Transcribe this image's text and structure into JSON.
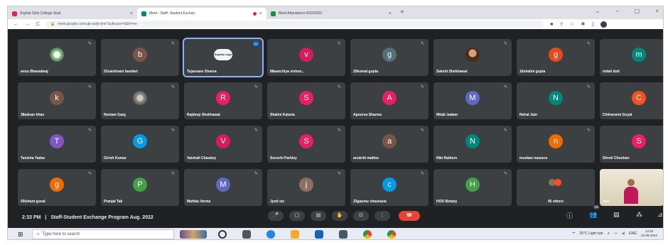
{
  "browser": {
    "tabs": [
      {
        "title": "Sophia Girls College Stud",
        "active": false,
        "favicon_color": "#e91e63"
      },
      {
        "title": "Meet - Staff- Student Exchan",
        "active": true,
        "favicon_color": "#00897b",
        "recording": true
      },
      {
        "title": "Meet Attendance 8/22/2022",
        "active": false,
        "favicon_color": "#1e8e3e"
      }
    ],
    "new_tab": "+",
    "url": "meet.google.com/ujb-uwjb-bmi?authuser=0&hl=en"
  },
  "participants": [
    {
      "name": "annu Bharadwaj",
      "initial": "",
      "photo": "flower",
      "color": ""
    },
    {
      "name": "52vaishnavi bandari",
      "initial": "b",
      "color": "#795548"
    },
    {
      "name": "Tejasvaee Sharva",
      "initial": "",
      "photo": "logo",
      "logo_text": "Sophia Logo",
      "color": "",
      "speaking": true,
      "badge": "•••"
    },
    {
      "name": "88aanchiya vishno...",
      "initial": "v",
      "color": "#d81b60"
    },
    {
      "name": "20komal gupta",
      "initial": "g",
      "color": "#546e7a"
    },
    {
      "name": "Sakshi Shekhawat",
      "initial": "",
      "photo": "face",
      "color": ""
    },
    {
      "name": "16shalini gupta",
      "initial": "g",
      "color": "#e64a19"
    },
    {
      "name": "mitali dutt",
      "initial": "m",
      "color": "#00897b"
    },
    {
      "name": "38adnan khan",
      "initial": "k",
      "color": "#795548"
    },
    {
      "name": "Neelam Garg",
      "initial": "",
      "photo": "group",
      "color": ""
    },
    {
      "name": "Rajdeep Shekhawat",
      "initial": "R",
      "color": "#e91e63"
    },
    {
      "name": "Shalini Kataria",
      "initial": "S",
      "color": "#e91e63"
    },
    {
      "name": "Apoorva Sharma",
      "initial": "A",
      "color": "#e91e63"
    },
    {
      "name": "Mitali Jadam",
      "initial": "M",
      "color": "#5c6bc0"
    },
    {
      "name": "Nehal Jain",
      "initial": "N",
      "color": "#00897b"
    },
    {
      "name": "Chitransini Goyal",
      "initial": "C",
      "color": "#f4511e"
    },
    {
      "name": "Tanisha Yadav",
      "initial": "T",
      "color": "#7e57c2"
    },
    {
      "name": "Girish Kumar",
      "initial": "G",
      "color": "#039be5"
    },
    {
      "name": "Vaishali Chaubey",
      "initial": "V",
      "color": "#d81b60"
    },
    {
      "name": "Suruchi Parkley",
      "initial": "S",
      "color": "#e91e63"
    },
    {
      "name": "anukriti mathur",
      "initial": "a",
      "color": "#795548"
    },
    {
      "name": "Niki Rathore",
      "initial": "N",
      "color": "#00897b"
    },
    {
      "name": "muskan naseera",
      "initial": "n",
      "color": "#ef6c00"
    },
    {
      "name": "Shruti Chouhan",
      "initial": "S",
      "color": "#e91e63"
    },
    {
      "name": "59ishant goval",
      "initial": "g",
      "color": "#ef6c00"
    },
    {
      "name": "Pranjal Tak",
      "initial": "P",
      "color": "#43a047"
    },
    {
      "name": "Mahika Verma",
      "initial": "M",
      "color": "#5c6bc0"
    },
    {
      "name": "Jyoti stc",
      "initial": "j",
      "color": "#8d6e63"
    },
    {
      "name": "33gaurav chaurasia",
      "initial": "c",
      "color": "#039be5"
    },
    {
      "name": "HOD Botany",
      "initial": "H",
      "color": "#43a047"
    },
    {
      "name": "45 others",
      "initial": "",
      "others": true,
      "color": ""
    }
  ],
  "self_view": {
    "name": "You"
  },
  "meeting": {
    "time": "2:33 PM",
    "separator": "|",
    "title": "Staff-Student Exchange Program Aug. 2022"
  },
  "controls": [
    {
      "id": "mic",
      "icon": "mic-icon",
      "glyph": "🎤"
    },
    {
      "id": "camera",
      "icon": "camera-icon",
      "glyph": "▢"
    },
    {
      "id": "captions",
      "icon": "captions-icon",
      "glyph": "▤"
    },
    {
      "id": "raise-hand",
      "icon": "raise-hand-icon",
      "glyph": "✋"
    },
    {
      "id": "present",
      "icon": "present-icon",
      "glyph": "⊡"
    },
    {
      "id": "more",
      "icon": "more-options-icon",
      "glyph": "⋮"
    },
    {
      "id": "leave",
      "icon": "end-call-icon",
      "glyph": "☎"
    }
  ],
  "right_controls": [
    {
      "id": "info",
      "glyph": "ⓘ"
    },
    {
      "id": "people",
      "glyph": "👥",
      "count": "79"
    },
    {
      "id": "chat",
      "glyph": "▤"
    },
    {
      "id": "activities",
      "glyph": "⁂"
    },
    {
      "id": "host",
      "glyph": "⊿"
    }
  ],
  "taskbar": {
    "search_placeholder": "Type here to search",
    "weather": "25°C  Light rain",
    "lang": "ENG",
    "time": "14:33",
    "date": "22-08-2022"
  }
}
